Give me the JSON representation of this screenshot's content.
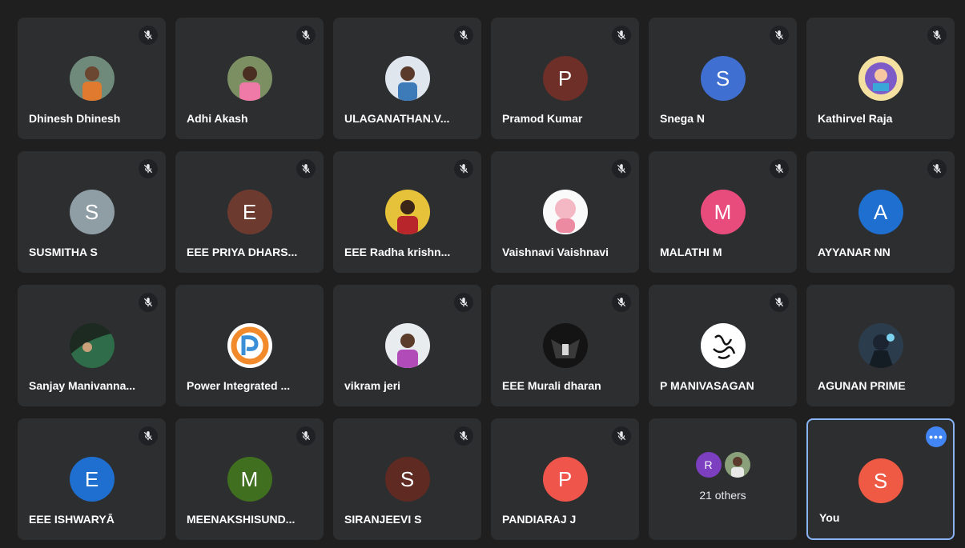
{
  "participants": [
    {
      "name": "Dhinesh Dhinesh",
      "initial": "",
      "color": "",
      "photo": "person-photo-orange",
      "muted": true
    },
    {
      "name": "Adhi Akash",
      "initial": "",
      "color": "",
      "photo": "person-photo-pink",
      "muted": true
    },
    {
      "name": "ULAGANATHAN.V...",
      "initial": "",
      "color": "",
      "photo": "person-photo-white",
      "muted": true
    },
    {
      "name": "Pramod Kumar",
      "initial": "P",
      "color": "#6d2f28",
      "muted": true
    },
    {
      "name": "Snega N",
      "initial": "S",
      "color": "#3f6fd1",
      "muted": true
    },
    {
      "name": "Kathirvel Raja",
      "initial": "",
      "color": "",
      "photo": "cartoon-photo",
      "muted": true
    },
    {
      "name": "SUSMITHA S",
      "initial": "S",
      "color": "#8f9ea5",
      "muted": true
    },
    {
      "name": "EEE PRIYA DHARS...",
      "initial": "E",
      "color": "#6d3a2f",
      "muted": true
    },
    {
      "name": "EEE Radha krishn...",
      "initial": "",
      "color": "",
      "photo": "person-photo-yellow",
      "muted": true
    },
    {
      "name": "Vaishnavi Vaishnavi",
      "initial": "",
      "color": "",
      "photo": "baby-photo",
      "muted": true
    },
    {
      "name": "MALATHI M",
      "initial": "M",
      "color": "#e84c7c",
      "muted": true
    },
    {
      "name": "AYYANAR NN",
      "initial": "A",
      "color": "#1e6fd0",
      "muted": true
    },
    {
      "name": "Sanjay Manivanna...",
      "initial": "",
      "color": "",
      "photo": "dark-green-photo",
      "muted": true
    },
    {
      "name": "Power Integrated ...",
      "initial": "",
      "color": "",
      "photo": "power-logo",
      "muted": false
    },
    {
      "name": "vikram jeri",
      "initial": "",
      "color": "",
      "photo": "person-photo-light",
      "muted": true
    },
    {
      "name": "EEE Murali dharan",
      "initial": "",
      "color": "",
      "photo": "dark-figure-photo",
      "muted": true
    },
    {
      "name": "P MANIVASAGAN",
      "initial": "",
      "color": "",
      "photo": "calligraphy-logo",
      "muted": true
    },
    {
      "name": "AGUNAN PRIME",
      "initial": "",
      "color": "",
      "photo": "game-character-photo",
      "muted": false
    },
    {
      "name": "EEE ISHWARYĀ",
      "initial": "E",
      "color": "#1e6fd0",
      "muted": true
    },
    {
      "name": "MEENAKSHISUND...",
      "initial": "M",
      "color": "#3f6f1f",
      "muted": true
    },
    {
      "name": "SIRANJEEVI S",
      "initial": "S",
      "color": "#5e2a22",
      "muted": true
    },
    {
      "name": "PANDIARAJ J",
      "initial": "P",
      "color": "#f0554b",
      "muted": true
    }
  ],
  "others": {
    "label": "21 others",
    "first_initial": "R",
    "first_color": "#7b3fbf"
  },
  "self": {
    "name": "You",
    "initial": "S",
    "color": "#ef5a45",
    "more_icon": "more-horiz-icon"
  },
  "icons": {
    "mute": "mic-off-icon"
  },
  "accent": "#8ab4f8"
}
